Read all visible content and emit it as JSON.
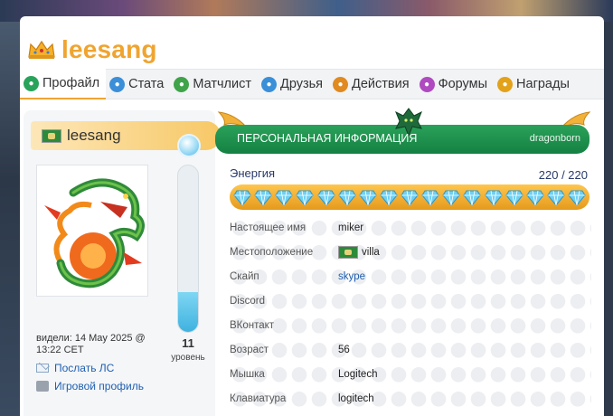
{
  "profile": {
    "username": "leesang"
  },
  "nav": {
    "items": [
      {
        "label": "Профайл",
        "icon": "profile-icon",
        "color": "#29a35b"
      },
      {
        "label": "Стата",
        "icon": "stats-icon",
        "color": "#3a8fd8"
      },
      {
        "label": "Матчлист",
        "icon": "matchlist-icon",
        "color": "#3fa34a"
      },
      {
        "label": "Друзья",
        "icon": "friends-icon",
        "color": "#3a8fd8"
      },
      {
        "label": "Действия",
        "icon": "actions-icon",
        "color": "#e08a20"
      },
      {
        "label": "Форумы",
        "icon": "forums-icon",
        "color": "#b04ac0"
      },
      {
        "label": "Награды",
        "icon": "awards-icon",
        "color": "#e3a21a"
      }
    ]
  },
  "sidebar": {
    "name": "leesang",
    "level": "11",
    "level_label": "уровень",
    "level_fill_fraction": 0.24,
    "seen": "видели: 14 May 2025 @ 13:22 CET",
    "send_pm": "Послать ЛС",
    "game_profile": "Игровой профиль"
  },
  "info": {
    "title": "ПЕРСОНАЛЬНАЯ ИНФОРМАЦИЯ",
    "race": "dragonborn",
    "energy_label": "Энергия",
    "energy_value": "220 / 220",
    "energy_current": 220,
    "energy_max": 220,
    "fields": [
      {
        "label": "Настоящее имя",
        "value": "miker"
      },
      {
        "label": "Местоположение",
        "value": "villa",
        "flag": true
      },
      {
        "label": "Скайп",
        "value": "skype",
        "link": true
      },
      {
        "label": "Discord",
        "value": ""
      },
      {
        "label": "ВКонтакт",
        "value": ""
      },
      {
        "label": "Возраст",
        "value": "56"
      },
      {
        "label": "Мышка",
        "value": "Logitech"
      },
      {
        "label": "Клавиатура",
        "value": "logitech"
      }
    ]
  },
  "colors": {
    "accent": "#f0a430",
    "header_green": "#1e9150",
    "link": "#1f5fb0"
  }
}
